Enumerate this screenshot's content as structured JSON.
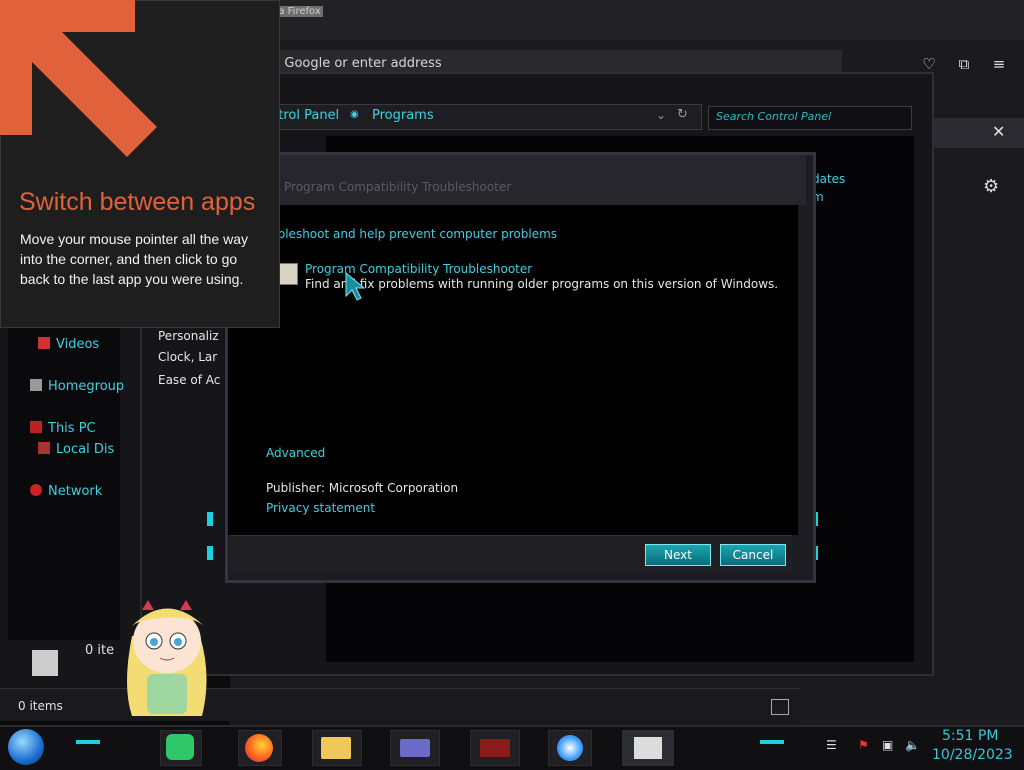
{
  "firefox": {
    "title": "Mozilla Firefox",
    "url_placeholder": "n Google or enter address",
    "panel_close": "✕",
    "gear": "⚙",
    "icons": [
      "pocket-icon",
      "extensions-icon",
      "menu-icon"
    ]
  },
  "control_panel": {
    "breadcrumb": [
      "ntrol Panel",
      "Programs"
    ],
    "search_placeholder": "Search Control Panel",
    "side_items": [
      "Personaliz",
      "Clock, Lar",
      "Ease of Ac"
    ],
    "right_links": [
      "dates",
      "m"
    ]
  },
  "explorer": {
    "nav": [
      {
        "label": "Videos",
        "icon": "videos-icon"
      },
      {
        "label": "Homegroup",
        "icon": "homegroup-icon"
      },
      {
        "label": "This PC",
        "icon": "pc-icon"
      },
      {
        "label": "Local Dis",
        "icon": "drive-icon"
      },
      {
        "label": "Network",
        "icon": "network-icon"
      }
    ],
    "status": "0 items",
    "items_count_partial": "0 ite"
  },
  "dialog": {
    "title": "Program Compatibility Troubleshooter",
    "heading": "ubleshoot and help prevent computer problems",
    "item_title": "Program Compatibility Troubleshooter",
    "item_desc": "Find and fix problems with running older programs on this version of Windows.",
    "advanced": "Advanced",
    "publisher": "Publisher:  Microsoft Corporation",
    "privacy": "Privacy statement",
    "next": "Next",
    "cancel": "Cancel"
  },
  "tip": {
    "title": "Switch between apps",
    "body": "Move your mouse pointer all the way into the corner, and then click to go back to the last app you were using."
  },
  "taskbar": {
    "time": "5:51 PM",
    "date": "10/28/2023",
    "apps": [
      "notes-icon",
      "firefox-icon",
      "file-explorer-icon",
      "control-panel-icon",
      "media-icon",
      "settings-icon",
      "troubleshooter-icon"
    ]
  },
  "colors": {
    "accent": "#3fd0e0",
    "tip_title": "#e0613a",
    "arrow": "#e0613a"
  }
}
